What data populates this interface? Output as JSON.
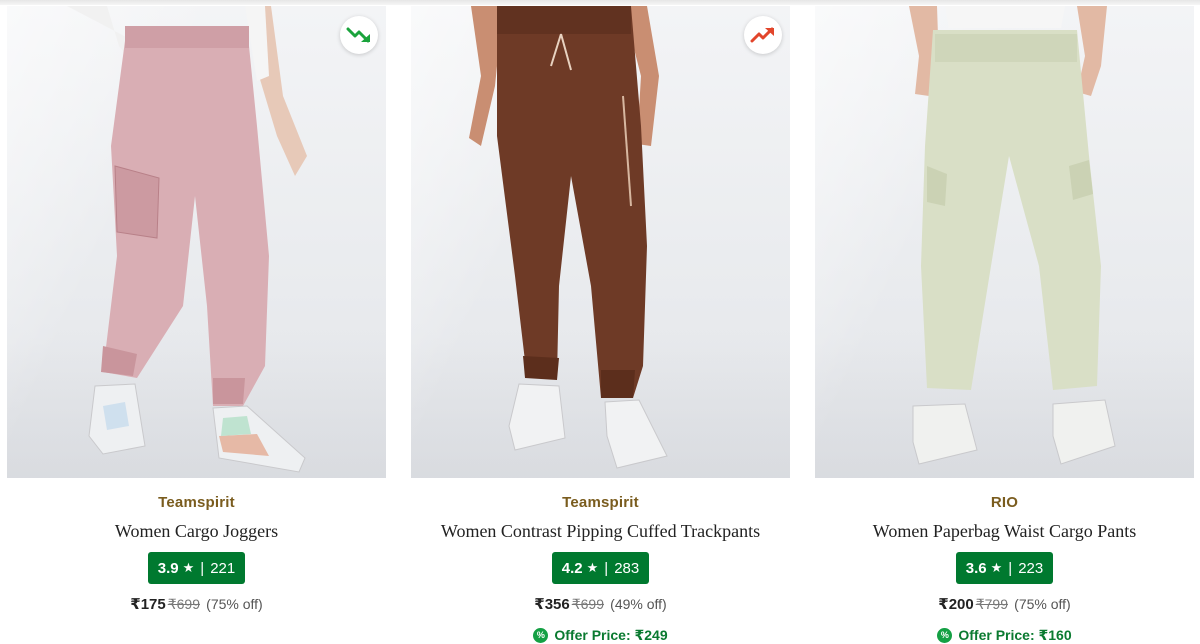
{
  "colors": {
    "rating_bg": "#00792f",
    "brand": "#7a5c1e",
    "offer": "#0a7a30",
    "trend_down": "#1aa33c",
    "trend_up": "#e2452b"
  },
  "products": [
    {
      "brand": "Teamspirit",
      "title": "Women Cargo Joggers",
      "rating": "3.9",
      "rating_count": "221",
      "price": "₹175",
      "mrp": "₹699",
      "discount": "(75% off)",
      "offer_price": "",
      "trend_icon": "trend-down-icon",
      "garment_color": "#d9aeb4"
    },
    {
      "brand": "Teamspirit",
      "title": "Women Contrast Pipping Cuffed Trackpants",
      "rating": "4.2",
      "rating_count": "283",
      "price": "₹356",
      "mrp": "₹699",
      "discount": "(49% off)",
      "offer_price": "Offer Price: ₹249",
      "trend_icon": "trend-up-icon",
      "garment_color": "#6e3a26"
    },
    {
      "brand": "RIO",
      "title": "Women Paperbag Waist Cargo Pants",
      "rating": "3.6",
      "rating_count": "223",
      "price": "₹200",
      "mrp": "₹799",
      "discount": "(75% off)",
      "offer_price": "Offer Price: ₹160",
      "trend_icon": "",
      "garment_color": "#d9dfc6"
    }
  ]
}
